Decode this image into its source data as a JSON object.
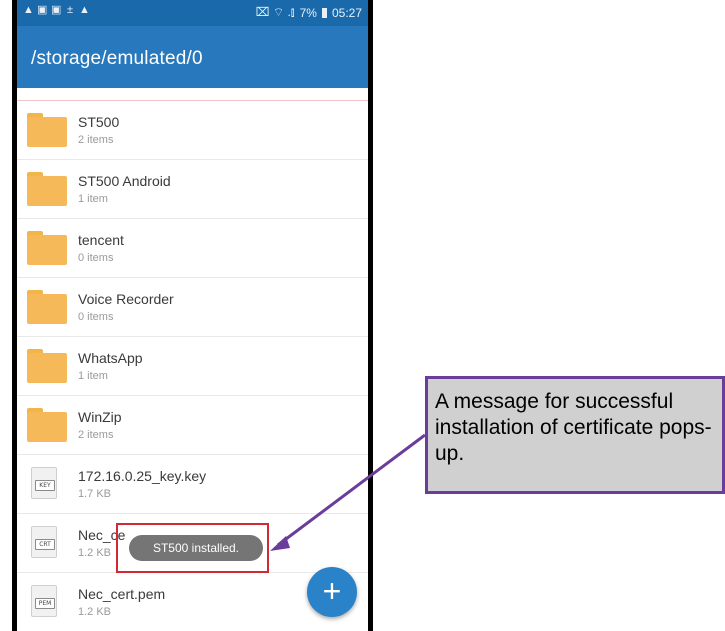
{
  "status_bar": {
    "left_icons": [
      "▲",
      "▣",
      "▣",
      "±",
      "▲"
    ],
    "right_icons_label": "⌧ ⌔ .⫾",
    "battery": "7%",
    "time": "05:27"
  },
  "app_bar": {
    "title": "/storage/emulated/0"
  },
  "files": [
    {
      "type": "folder",
      "name": "ST500",
      "sub": "2 items"
    },
    {
      "type": "folder",
      "name": "ST500 Android",
      "sub": "1 item"
    },
    {
      "type": "folder",
      "name": "tencent",
      "sub": "0 items"
    },
    {
      "type": "folder",
      "name": "Voice Recorder",
      "sub": "0 items"
    },
    {
      "type": "folder",
      "name": "WhatsApp",
      "sub": "1 item"
    },
    {
      "type": "folder",
      "name": "WinZip",
      "sub": "2 items"
    },
    {
      "type": "file",
      "ext": "KEY",
      "name": "172.16.0.25_key.key",
      "sub": "1.7 KB"
    },
    {
      "type": "file",
      "ext": "CRT",
      "name": "Nec_ce",
      "sub": "1.2 KB"
    },
    {
      "type": "file",
      "ext": "PEM",
      "name": "Nec_cert.pem",
      "sub": "1.2 KB"
    }
  ],
  "toast": {
    "text": "ST500 installed."
  },
  "fab": {
    "icon": "plus-icon",
    "glyph": "+"
  },
  "callout": {
    "text": "A message for successful installation of certificate pops-up."
  },
  "colors": {
    "app_bar": "#2778bd",
    "status_bar": "#1a6aab",
    "highlight": "#d12a36",
    "callout_border": "#6a3d9a",
    "folder": "#f5b95a"
  }
}
